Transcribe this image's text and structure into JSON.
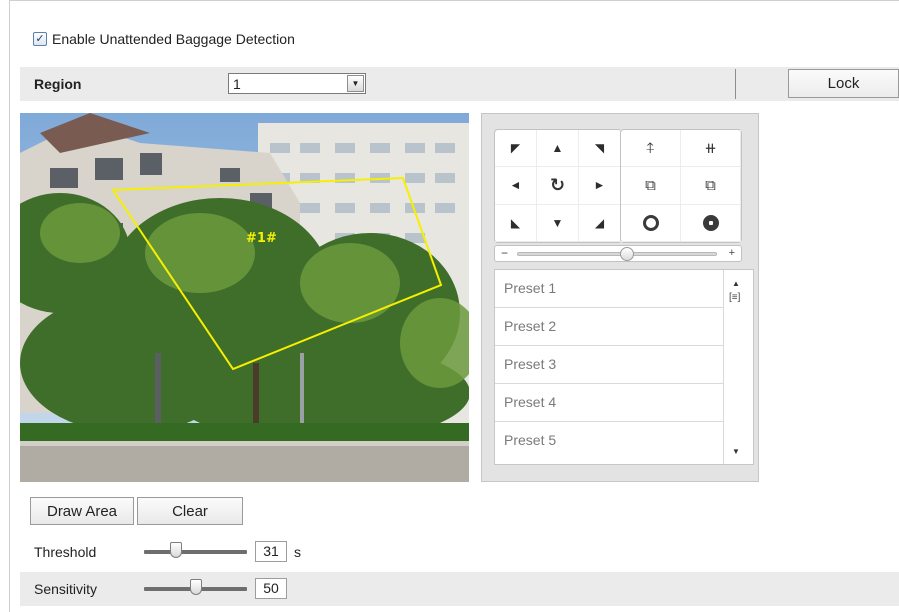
{
  "detection": {
    "enable_label": "Enable Unattended Baggage Detection",
    "enabled": true
  },
  "region": {
    "label": "Region",
    "selected": "1",
    "lock_label": "Lock"
  },
  "video": {
    "roi_label": "#1#",
    "roi_color": "#f5f000"
  },
  "ptz": {
    "directions": [
      "▼",
      "▲",
      "◄",
      "◄",
      "↻",
      "►",
      "▲",
      "▼",
      "◄"
    ],
    "speed_minus": "−",
    "speed_plus": "+",
    "speed_level": 0.55,
    "presets": [
      "Preset 1",
      "Preset 2",
      "Preset 3",
      "Preset 4",
      "Preset 5"
    ]
  },
  "actions": {
    "draw_area": "Draw Area",
    "clear": "Clear"
  },
  "threshold": {
    "label": "Threshold",
    "value": "31",
    "unit": "s",
    "level": 0.31
  },
  "sensitivity": {
    "label": "Sensitivity",
    "value": "50",
    "level": 0.5
  }
}
